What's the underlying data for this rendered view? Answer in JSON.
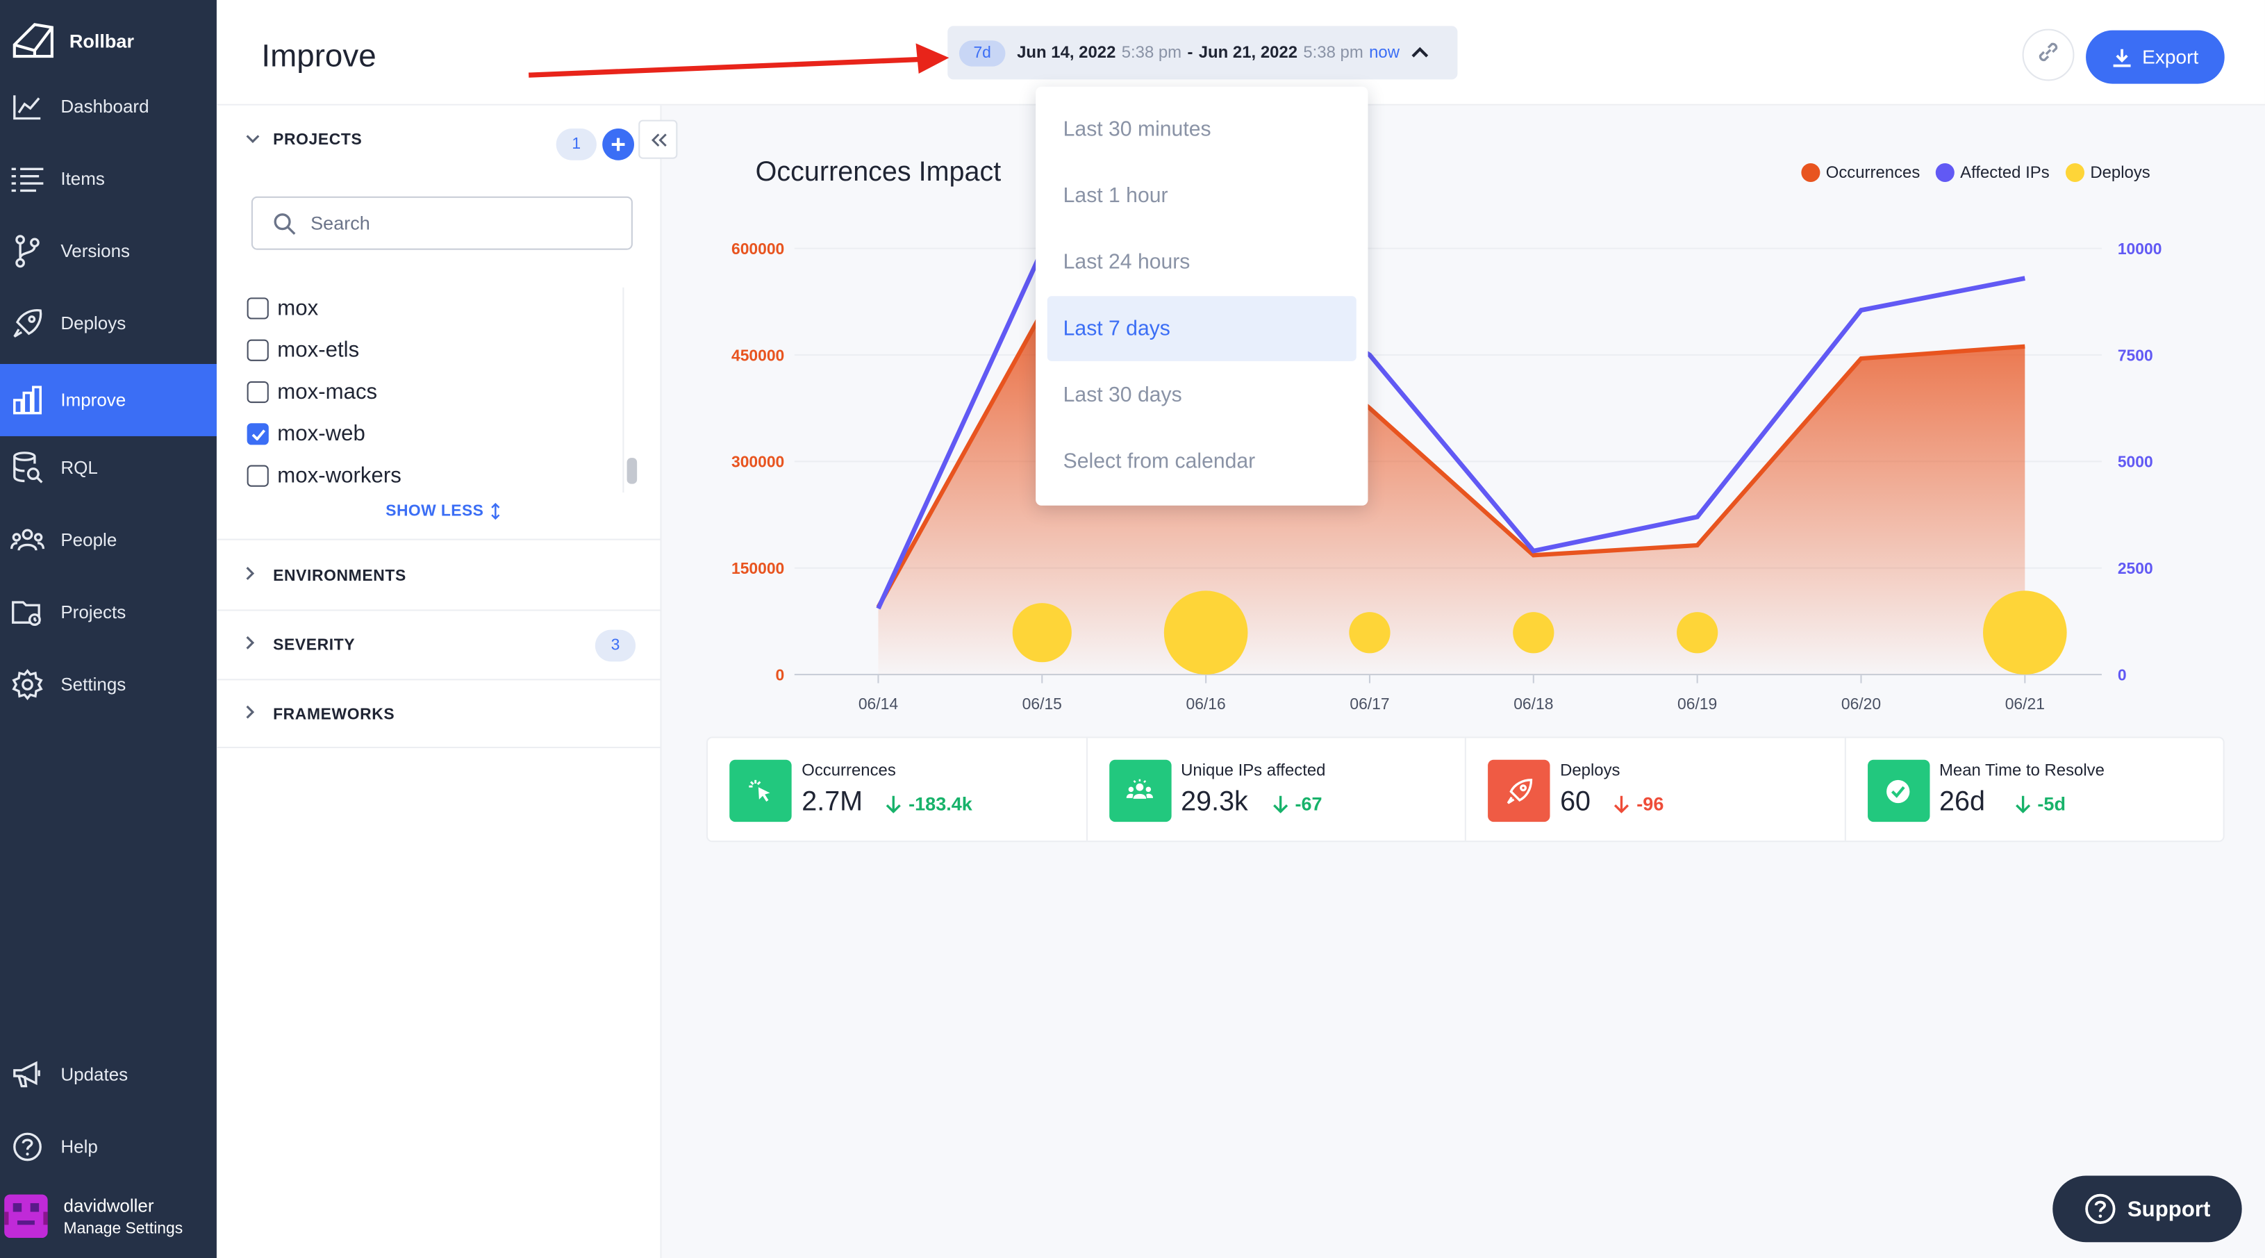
{
  "app": {
    "name": "Rollbar"
  },
  "sidebar": {
    "items": [
      {
        "label": "Dashboard",
        "icon": "dashboard-icon"
      },
      {
        "label": "Items",
        "icon": "items-icon"
      },
      {
        "label": "Versions",
        "icon": "versions-icon"
      },
      {
        "label": "Deploys",
        "icon": "deploys-icon"
      },
      {
        "label": "Improve",
        "icon": "improve-icon",
        "active": true
      },
      {
        "label": "RQL",
        "icon": "rql-icon"
      },
      {
        "label": "People",
        "icon": "people-icon"
      },
      {
        "label": "Projects",
        "icon": "projects-icon"
      },
      {
        "label": "Settings",
        "icon": "settings-icon"
      }
    ],
    "bottom_items": [
      {
        "label": "Updates",
        "icon": "megaphone-icon"
      },
      {
        "label": "Help",
        "icon": "help-icon"
      }
    ],
    "user": {
      "name": "davidwoller",
      "subtitle": "Manage Settings"
    }
  },
  "header": {
    "title": "Improve",
    "date_range": {
      "badge": "7d",
      "start_date": "Jun 14, 2022",
      "start_time": "5:38 pm",
      "separator": "-",
      "end_date": "Jun 21, 2022",
      "end_time": "5:38 pm",
      "now": "now"
    },
    "export_label": "Export"
  },
  "filters": {
    "projects": {
      "title": "PROJECTS",
      "count": "1",
      "search_placeholder": "Search",
      "items": [
        {
          "label": "mox",
          "checked": false
        },
        {
          "label": "mox-etls",
          "checked": false
        },
        {
          "label": "mox-macs",
          "checked": false
        },
        {
          "label": "mox-web",
          "checked": true
        },
        {
          "label": "mox-workers",
          "checked": false
        }
      ],
      "show_less": "SHOW LESS"
    },
    "environments": {
      "title": "ENVIRONMENTS"
    },
    "severity": {
      "title": "SEVERITY",
      "count": "3"
    },
    "frameworks": {
      "title": "FRAMEWORKS"
    }
  },
  "dropdown": {
    "options": [
      "Last 30 minutes",
      "Last 1 hour",
      "Last 24 hours",
      "Last 7 days",
      "Last 30 days",
      "Select from calendar"
    ],
    "selected": "Last 7 days"
  },
  "chart_data": {
    "type": "area",
    "title": "Occurrences Impact",
    "categories": [
      "06/14",
      "06/15",
      "06/16",
      "06/17",
      "06/18",
      "06/19",
      "06/20",
      "06/21"
    ],
    "ylim_left": [
      0,
      600000
    ],
    "yticks_left": [
      "0",
      "150000",
      "300000",
      "450000",
      "600000"
    ],
    "ylim_right": [
      0,
      10000
    ],
    "yticks_right": [
      "0",
      "2500",
      "5000",
      "7500",
      "10000"
    ],
    "legend_position": "top-right",
    "series": [
      {
        "name": "Occurrences",
        "axis": "left",
        "kind": "area",
        "color": "#e8541f",
        "values": [
          95000,
          510000,
          570000,
          375000,
          168000,
          182000,
          445000,
          462000
        ]
      },
      {
        "name": "Affected IPs",
        "axis": "right",
        "kind": "line",
        "color": "#6159f4",
        "values": [
          1550,
          9950,
          9950,
          7500,
          2900,
          3700,
          8550,
          9300
        ]
      },
      {
        "name": "Deploys",
        "kind": "bubble",
        "color": "#fed538",
        "values": [
          0,
          12,
          34,
          3,
          3,
          3,
          0,
          34
        ]
      }
    ]
  },
  "stats": [
    {
      "label": "Occurrences",
      "value": "2.7M",
      "delta": "-183.4k",
      "delta_color": "#17b26a",
      "icon": "cursor-click-icon",
      "color": "#22c87e"
    },
    {
      "label": "Unique IPs affected",
      "value": "29.3k",
      "delta": "-67",
      "delta_color": "#17b26a",
      "icon": "users-icon",
      "color": "#22c87e"
    },
    {
      "label": "Deploys",
      "value": "60",
      "delta": "-96",
      "delta_color": "#ee4c38",
      "icon": "rocket-icon",
      "color": "#ef5b44"
    },
    {
      "label": "Mean Time to Resolve",
      "value": "26d",
      "delta": "-5d",
      "delta_color": "#17b26a",
      "icon": "check-circle-icon",
      "color": "#22c87e"
    }
  ],
  "support": {
    "label": "Support"
  }
}
